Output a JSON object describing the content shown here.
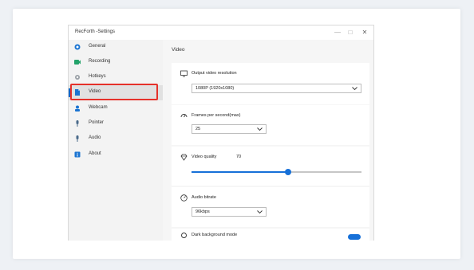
{
  "window": {
    "title": "RecForth -Settings"
  },
  "controls": {
    "minimize": "—",
    "maximize": "□",
    "close": "✕"
  },
  "sidebar": {
    "items": [
      {
        "label": "General",
        "icon": "home-icon",
        "color": "#1b74d2"
      },
      {
        "label": "Recording",
        "icon": "record-icon",
        "color": "#23a36a"
      },
      {
        "label": "Hotkeys",
        "icon": "hotkey-icon",
        "color": "#9aa0a6"
      },
      {
        "label": "Video",
        "icon": "video-icon",
        "color": "#1b74d2"
      },
      {
        "label": "Webcam",
        "icon": "webcam-icon",
        "color": "#1b74d2"
      },
      {
        "label": "Pointer",
        "icon": "pointer-icon",
        "color": "#4a6a8a"
      },
      {
        "label": "Audio",
        "icon": "audio-icon",
        "color": "#4a6a8a"
      },
      {
        "label": "About",
        "icon": "about-icon",
        "color": "#1b74d2"
      }
    ],
    "active": "Video"
  },
  "main": {
    "section_title": "Video",
    "resolution": {
      "label": "Output video resolution",
      "value": "1080P (1920x1080)"
    },
    "fps": {
      "label": "Frames per second(max)",
      "value": "25"
    },
    "quality": {
      "label": "Video quality",
      "value": "70",
      "level": 0.57
    },
    "bitrate": {
      "label": "Audio bitrate",
      "value": "96kbps"
    },
    "partial_row": {
      "label": "Dark background mode",
      "toggle": true
    }
  }
}
